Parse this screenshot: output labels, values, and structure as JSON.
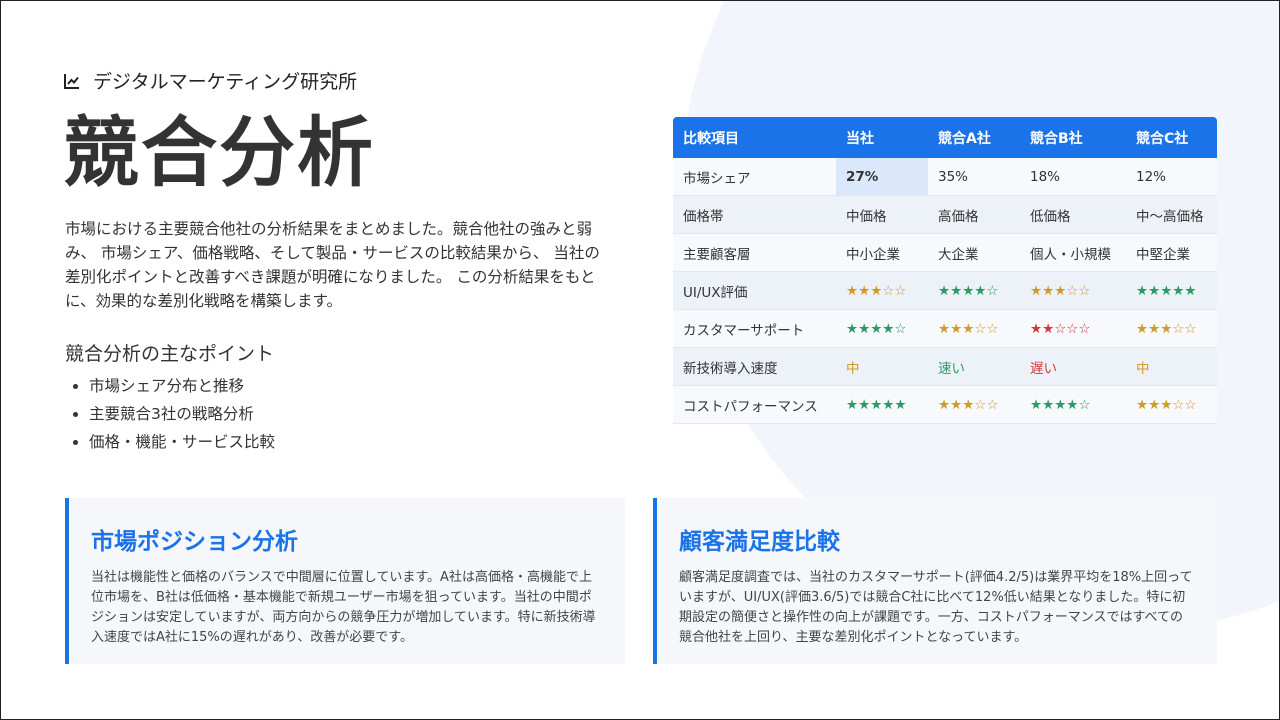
{
  "brand": {
    "name": "デジタルマーケティング研究所",
    "icon": "line-chart-icon"
  },
  "title": "競合分析",
  "intro": "市場における主要競合他社の分析結果をまとめました。競合他社の強みと弱み、 市場シェア、価格戦略、そして製品・サービスの比較結果から、 当社の差別化ポイントと改善すべき課題が明確になりました。 この分析結果をもとに、効果的な差別化戦略を構築します。",
  "points": {
    "heading": "競合分析の主なポイント",
    "items": [
      "市場シェア分布と推移",
      "主要競合3社の戦略分析",
      "価格・機能・サービス比較"
    ]
  },
  "table": {
    "headers": [
      "比較項目",
      "当社",
      "競合A社",
      "競合B社",
      "競合C社"
    ],
    "rows": [
      {
        "label": "市場シェア",
        "cells": [
          {
            "text": "27%",
            "tone": "",
            "highlight": true
          },
          {
            "text": "35%",
            "tone": ""
          },
          {
            "text": "18%",
            "tone": ""
          },
          {
            "text": "12%",
            "tone": ""
          }
        ]
      },
      {
        "label": "価格帯",
        "cells": [
          {
            "text": "中価格",
            "tone": ""
          },
          {
            "text": "高価格",
            "tone": ""
          },
          {
            "text": "低価格",
            "tone": ""
          },
          {
            "text": "中～高価格",
            "tone": ""
          }
        ]
      },
      {
        "label": "主要顧客層",
        "cells": [
          {
            "text": "中小企業",
            "tone": ""
          },
          {
            "text": "大企業",
            "tone": ""
          },
          {
            "text": "個人・小規模",
            "tone": ""
          },
          {
            "text": "中堅企業",
            "tone": ""
          }
        ]
      },
      {
        "label": "UI/UX評価",
        "cells": [
          {
            "text": "★★★☆☆",
            "tone": "gold"
          },
          {
            "text": "★★★★☆",
            "tone": "green"
          },
          {
            "text": "★★★☆☆",
            "tone": "gold"
          },
          {
            "text": "★★★★★",
            "tone": "green"
          }
        ]
      },
      {
        "label": "カスタマーサポート",
        "cells": [
          {
            "text": "★★★★☆",
            "tone": "green"
          },
          {
            "text": "★★★☆☆",
            "tone": "gold"
          },
          {
            "text": "★★☆☆☆",
            "tone": "red"
          },
          {
            "text": "★★★☆☆",
            "tone": "gold"
          }
        ]
      },
      {
        "label": "新技術導入速度",
        "cells": [
          {
            "text": "中",
            "tone": "gold"
          },
          {
            "text": "速い",
            "tone": "green"
          },
          {
            "text": "遅い",
            "tone": "red"
          },
          {
            "text": "中",
            "tone": "gold"
          }
        ]
      },
      {
        "label": "コストパフォーマンス",
        "cells": [
          {
            "text": "★★★★★",
            "tone": "green"
          },
          {
            "text": "★★★☆☆",
            "tone": "gold"
          },
          {
            "text": "★★★★☆",
            "tone": "green"
          },
          {
            "text": "★★★☆☆",
            "tone": "gold"
          }
        ]
      }
    ]
  },
  "cards": [
    {
      "title": "市場ポジション分析",
      "body": "当社は機能性と価格のバランスで中間層に位置しています。A社は高価格・高機能で上位市場を、B社は低価格・基本機能で新規ユーザー市場を狙っています。当社の中間ポジションは安定していますが、両方向からの競争圧力が増加しています。特に新技術導入速度ではA社に15%の遅れがあり、改善が必要です。"
    },
    {
      "title": "顧客満足度比較",
      "body": "顧客満足度調査では、当社のカスタマーサポート(評価4.2/5)は業界平均を18%上回っていますが、UI/UX(評価3.6/5)では競合C社に比べて12%低い結果となりました。特に初期設定の簡便さと操作性の向上が課題です。一方、コストパフォーマンスではすべての競合他社を上回り、主要な差別化ポイントとなっています。"
    }
  ],
  "colors": {
    "accent": "#1a73e8",
    "positive": "#2b9a66",
    "neutral": "#d19a2b",
    "negative": "#d03a3a"
  }
}
